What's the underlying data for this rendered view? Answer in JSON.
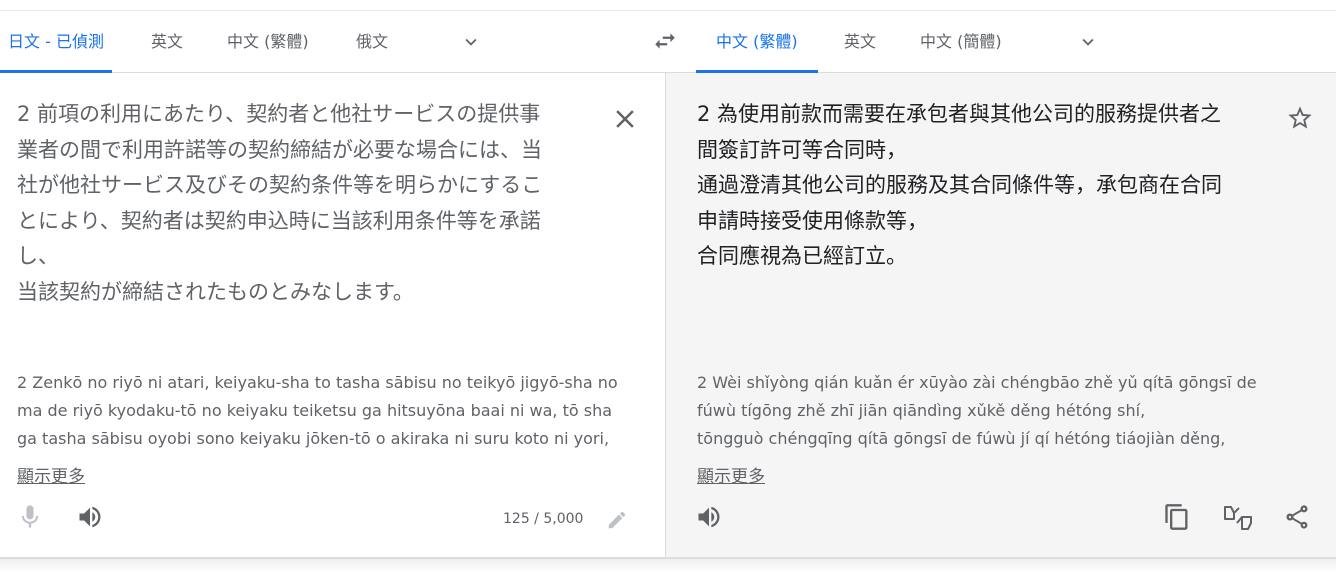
{
  "source_tabs": [
    "日文 - 已偵測",
    "英文",
    "中文 (繁體)",
    "俄文"
  ],
  "target_tabs": [
    "中文 (繁體)",
    "英文",
    "中文 (簡體)"
  ],
  "source": {
    "lines": [
      "2 前項の利用にあたり、契約者と他社サービスの提供事",
      "業者の間で利用許諾等の契約締結が必要な場合には、当",
      "社が他社サービス及びその契約条件等を明らかにするこ",
      "とにより、契約者は契約申込時に当該利用条件等を承諾",
      "し、",
      "当該契約が締結されたものとみなします。"
    ],
    "transliteration": [
      "2 Zenkō no riyō ni atari, keiyaku-sha to tasha sābisu no teikyō jigyō-sha no",
      "ma de riyō kyodaku-tō no keiyaku teiketsu ga hitsuyōna baai ni wa, tō sha",
      "ga tasha sābisu oyobi sono keiyaku jōken-tō o akiraka ni suru koto ni yori,"
    ],
    "show_more": "顯示更多",
    "char_count": "125 / 5,000"
  },
  "target": {
    "lines": [
      "2 為使用前款而需要在承包者與其他公司的服務提供者之",
      "間簽訂許可等合同時，",
      "通過澄清其他公司的服務及其合同條件等，承包商在合同",
      "申請時接受使用條款等，",
      "合同應視為已經訂立。"
    ],
    "transliteration": [
      "2 Wèi shǐyòng qián kuǎn ér xūyào zài chéngbāo zhě yǔ qítā gōngsī de",
      "fúwù tígōng zhě zhī jiān qiāndìng xǔkě děng hétóng shí,",
      "tōngguò chéngqīng qítā gōngsī de fúwù jí qí hétóng tiáojiàn děng,"
    ],
    "show_more": "顯示更多"
  },
  "colors": {
    "accent": "#1a73e8",
    "text": "#3c4043",
    "muted": "#5f6368",
    "target_bg": "#f5f5f5"
  },
  "icons": [
    "chevron-down-icon",
    "swap-icon",
    "close-icon",
    "star-icon",
    "mic-icon",
    "speaker-icon",
    "edit-icon",
    "copy-icon",
    "feedback-icon",
    "share-icon"
  ]
}
